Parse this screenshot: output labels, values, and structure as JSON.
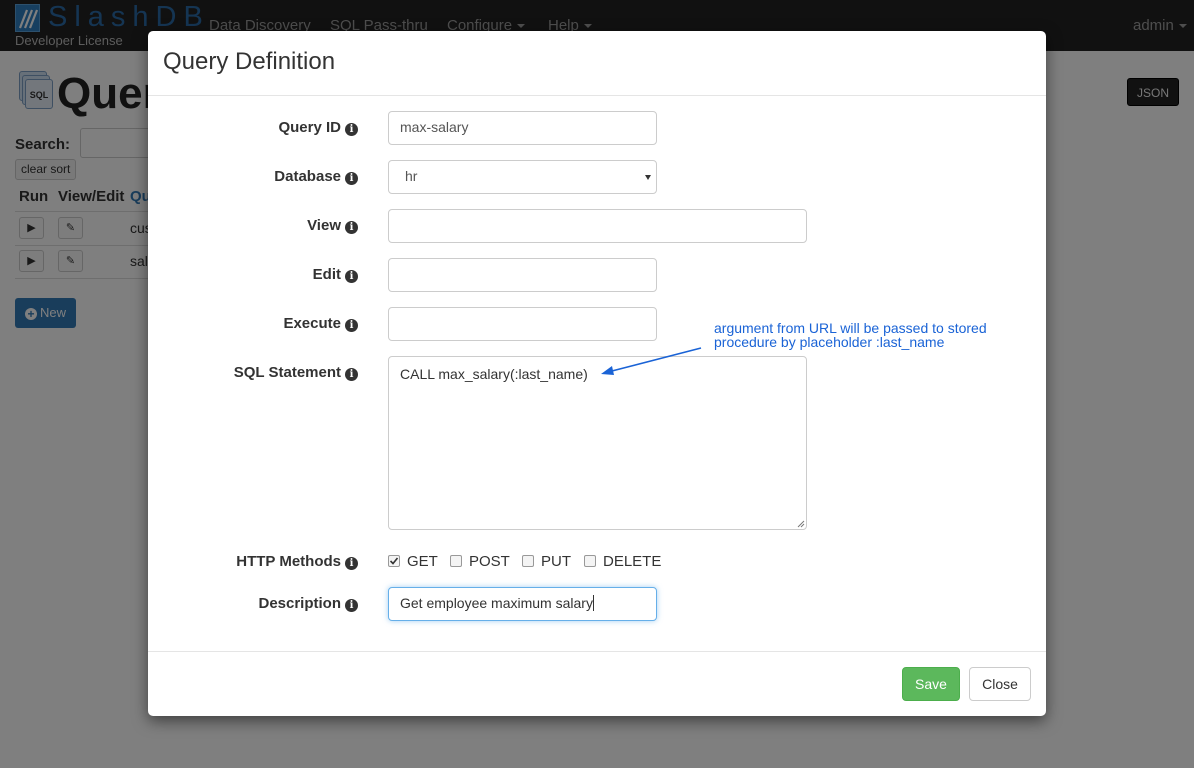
{
  "navbar": {
    "brand": "SlashDB",
    "license": "Developer License",
    "items": [
      {
        "label": "Data Discovery"
      },
      {
        "label": "SQL Pass-thru"
      },
      {
        "label": "Configure"
      },
      {
        "label": "Help"
      }
    ],
    "user": "admin"
  },
  "page": {
    "title": "Quer",
    "icon_text": "SQL",
    "json_button": "JSON",
    "search_label": "Search:",
    "clear_sort": "clear sort",
    "columns": [
      "Run",
      "View/Edit",
      "Qu"
    ],
    "rows": [
      {
        "name": "cus"
      },
      {
        "name": "sal"
      }
    ],
    "new_button": "New"
  },
  "modal": {
    "title": "Query Definition",
    "fields": {
      "query_id": {
        "label": "Query ID",
        "value": "max-salary"
      },
      "database": {
        "label": "Database",
        "value": "hr"
      },
      "view": {
        "label": "View",
        "value": ""
      },
      "edit": {
        "label": "Edit",
        "value": ""
      },
      "execute": {
        "label": "Execute",
        "value": ""
      },
      "sql": {
        "label": "SQL Statement",
        "value": "CALL max_salary(:last_name)"
      },
      "http_methods": {
        "label": "HTTP Methods",
        "options": [
          {
            "label": "GET",
            "checked": true
          },
          {
            "label": "POST",
            "checked": false
          },
          {
            "label": "PUT",
            "checked": false
          },
          {
            "label": "DELETE",
            "checked": false
          }
        ]
      },
      "description": {
        "label": "Description",
        "value": "Get employee maximum salary"
      }
    },
    "annotation": {
      "line1": "argument from URL will be passed to stored",
      "line2": "procedure by placeholder :last_name",
      "color": "#1a63d6"
    },
    "save_button": "Save",
    "close_button": "Close"
  }
}
